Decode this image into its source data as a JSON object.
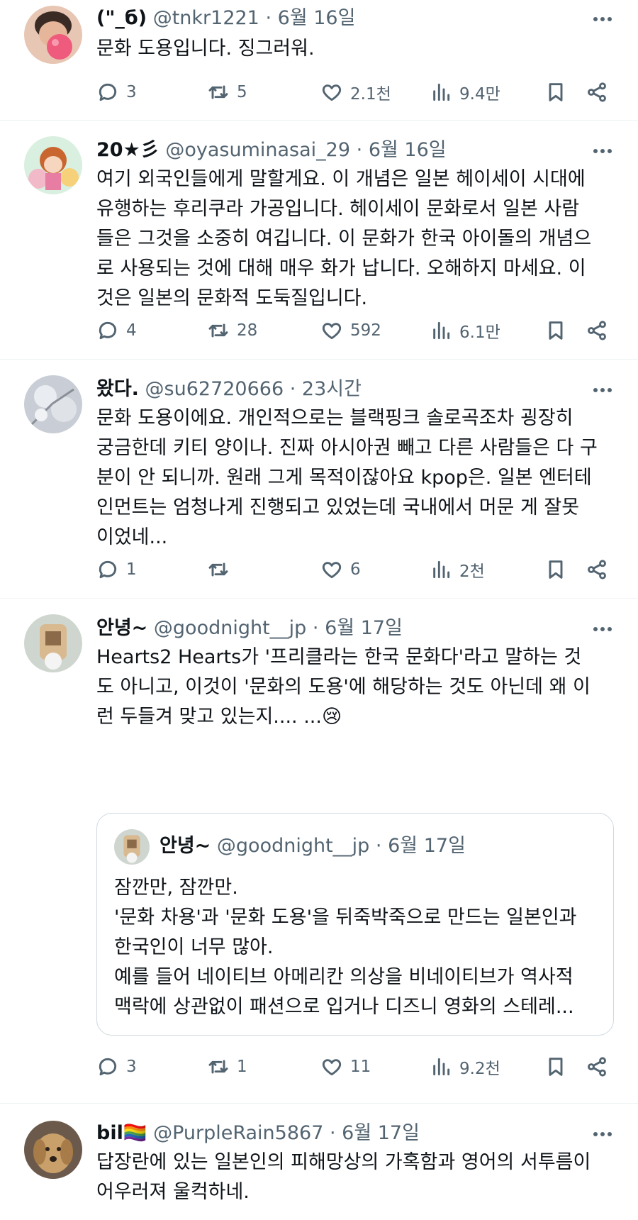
{
  "tweets": [
    {
      "name": "(\"_б)",
      "handle": "@tnkr1221",
      "time": "6월 16일",
      "text": "문화 도용입니다. 징그러워.",
      "replies": "3",
      "retweets": "5",
      "likes": "2.1천",
      "views": "9.4만"
    },
    {
      "name": "20★彡",
      "handle": "@oyasuminasai_29",
      "time": "6월 16일",
      "text": "여기 외국인들에게 말할게요. 이 개념은 일본 헤이세이 시대에\n유행하는 후리쿠라 가공입니다. 헤이세이 문화로서 일본 사람\n들은 그것을 소중히 여깁니다. 이 문화가 한국 아이돌의 개념으\n로 사용되는 것에 대해 매우 화가 납니다. 오해하지 마세요. 이\n것은 일본의 문화적 도둑질입니다.",
      "replies": "4",
      "retweets": "28",
      "likes": "592",
      "views": "6.1만"
    },
    {
      "name": "왔다.",
      "handle": "@su62720666",
      "time": "23시간",
      "text": "문화 도용이에요. 개인적으로는 블랙핑크 솔로곡조차 굉장히\n궁금한데 키티 양이나. 진짜 아시아권 빼고 다른 사람들은 다 구\n분이 안 되니까. 원래 그게 목적이잖아요 kpop은. 일본 엔터테\n인먼트는 엄청나게 진행되고 있었는데 국내에서 머문 게 잘못\n이었네...",
      "replies": "1",
      "retweets": "",
      "likes": "6",
      "views": "2천"
    },
    {
      "name": "안녕~",
      "handle": "@goodnight__jp",
      "time": "6월 17일",
      "text": "Hearts2 Hearts가 '프리클라는 한국 문화다'라고 말하는 것\n도 아니고, 이것이 '문화의 도용'에 해당하는 것도 아닌데 왜 이\n런 두들겨 맞고 있는지.... ...😢",
      "quote": {
        "name": "안녕~",
        "handle": "@goodnight__jp",
        "time": "6월 17일",
        "text": "잠깐만, 잠깐만.\n'문화 차용'과 '문화 도용'을 뒤죽박죽으로 만드는 일본인과\n한국인이 너무 많아.\n예를 들어 네이티브 아메리칸 의상을 비네이티브가 역사적\n맥락에 상관없이 패션으로 입거나 디즈니 영화의 스테레..."
      },
      "replies": "3",
      "retweets": "1",
      "likes": "11",
      "views": "9.2천"
    },
    {
      "name": "bil🏳️‍🌈",
      "handle": "@PurpleRain5867",
      "time": "6월 17일",
      "text": "답장란에 있는 일본인의 피해망상의 가혹함과 영어의 서투름이\n어우러져 울컥하네."
    }
  ],
  "ui": {
    "separator": "·"
  },
  "colors": {
    "text": "#0f1419",
    "secondary": "#536471",
    "border": "#eff3f4"
  }
}
